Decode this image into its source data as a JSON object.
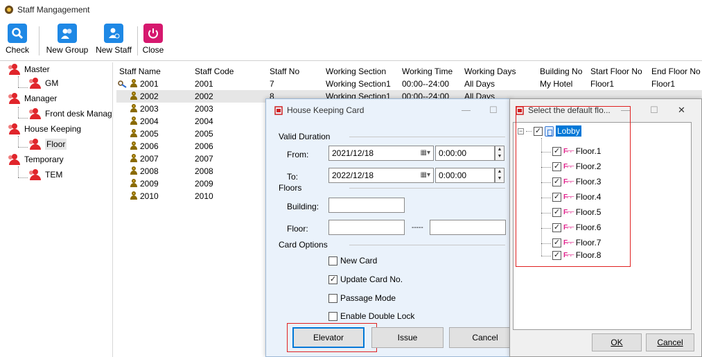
{
  "window": {
    "title": "Staff Mangagement"
  },
  "toolbar": {
    "check_label": "Check",
    "new_group_label": "New Group",
    "new_staff_label": "New Staff",
    "close_label": "Close"
  },
  "tree": {
    "master": "Master",
    "gm": "GM",
    "manager": "Manager",
    "front_desk": "Front desk Manag",
    "house_keeping": "House Keeping",
    "floor": "Floor",
    "temporary": "Temporary",
    "tem": "TEM"
  },
  "grid": {
    "headers": [
      "Staff Name",
      "Staff Code",
      "Staff No",
      "Working Section",
      "Working Time",
      "Working Days",
      "Building No",
      "Start Floor No",
      "End Floor No"
    ],
    "rows": [
      {
        "name": "2001",
        "code": "2001",
        "no": "7",
        "section": "Working Section1",
        "time": "00:00--24:00",
        "days": "All Days",
        "building": "My Hotel",
        "start": "Floor1",
        "end": "Floor1"
      },
      {
        "name": "2002",
        "code": "2002",
        "no": "8",
        "section": "Working Section1",
        "time": "00:00--24:00",
        "days": "All Days",
        "building": "",
        "start": "",
        "end": ""
      },
      {
        "name": "2003",
        "code": "2003"
      },
      {
        "name": "2004",
        "code": "2004"
      },
      {
        "name": "2005",
        "code": "2005"
      },
      {
        "name": "2006",
        "code": "2006"
      },
      {
        "name": "2007",
        "code": "2007"
      },
      {
        "name": "2008",
        "code": "2008"
      },
      {
        "name": "2009",
        "code": "2009"
      },
      {
        "name": "2010",
        "code": "2010"
      }
    ]
  },
  "card_dialog": {
    "title": "House Keeping Card",
    "valid_duration": "Valid Duration",
    "from_label": "From:",
    "from_date": "2021/12/18",
    "from_time": "0:00:00",
    "to_label": "To:",
    "to_date": "2022/12/18",
    "to_time": "0:00:00",
    "floors": "Floors",
    "building_label": "Building:",
    "floor_label": "Floor:",
    "floor_sep": "-----",
    "card_options": "Card Options",
    "opt_new_card": "New Card",
    "opt_update_card": "Update Card No.",
    "opt_passage": "Passage Mode",
    "opt_double_lock": "Enable Double Lock",
    "elevator_label": "Elevator",
    "issue_label": "Issue",
    "cancel_label": "Cancel"
  },
  "floor_dialog": {
    "title": "Select the default flo...",
    "root": "Lobby",
    "floors": [
      "Floor.1",
      "Floor.2",
      "Floor.3",
      "Floor.4",
      "Floor.5",
      "Floor.6",
      "Floor.7",
      "Floor.8"
    ],
    "ok_label": "OK",
    "cancel_label": "Cancel"
  },
  "colors": {
    "accent": "#0078d7",
    "highlight": "#e02020",
    "dialog_bg": "#eaf2fb"
  }
}
